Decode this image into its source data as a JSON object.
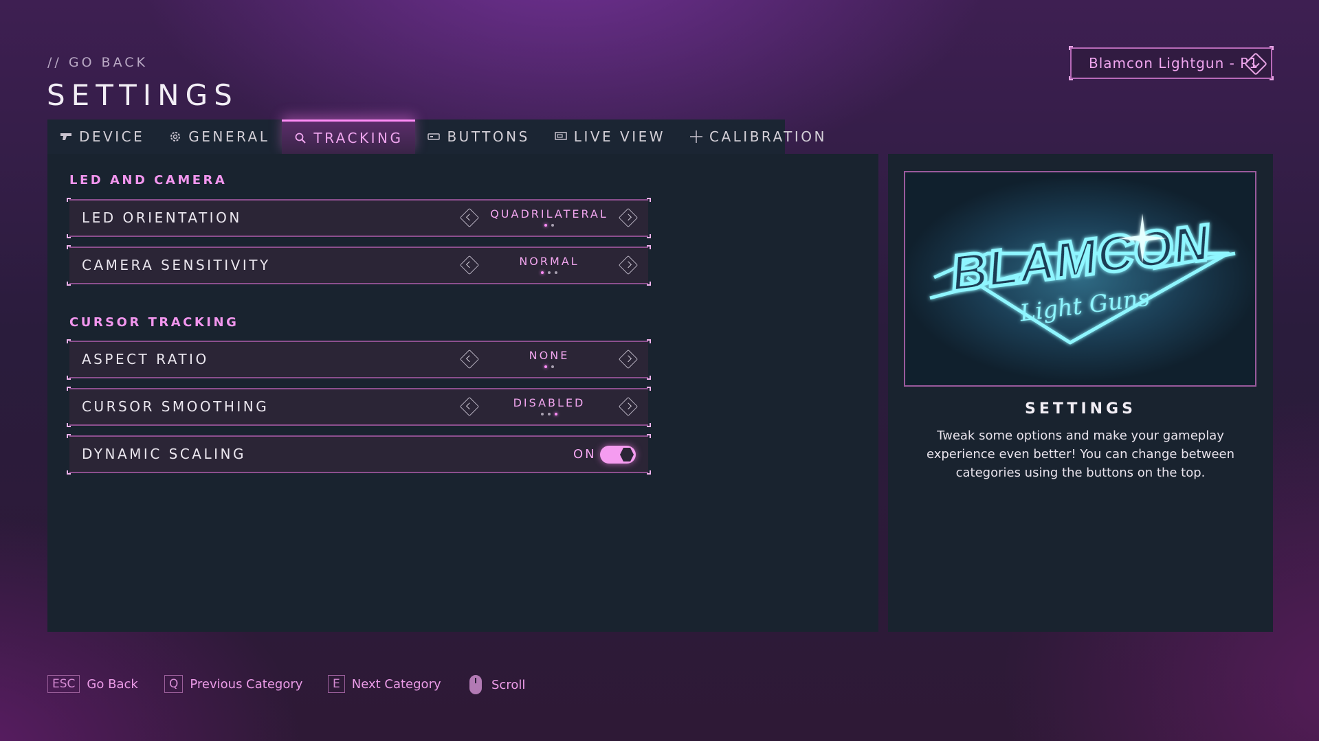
{
  "header": {
    "go_back": "// GO BACK",
    "title": "SETTINGS",
    "device_selector": "Blamcon Lightgun - P1"
  },
  "tabs": [
    {
      "label": "DEVICE",
      "icon": "lightgun-icon",
      "active": false
    },
    {
      "label": "GENERAL",
      "icon": "gear-icon",
      "active": false
    },
    {
      "label": "TRACKING",
      "icon": "search-icon",
      "active": true
    },
    {
      "label": "BUTTONS",
      "icon": "buttons-icon",
      "active": false
    },
    {
      "label": "LIVE VIEW",
      "icon": "monitor-icon",
      "active": false
    },
    {
      "label": "CALIBRATION",
      "icon": "crosshair-icon",
      "active": false
    }
  ],
  "sections": {
    "led_camera": {
      "title": "LED AND CAMERA",
      "led_orientation": {
        "label": "LED ORIENTATION",
        "value": "QUADRILATERAL",
        "option_count": 2,
        "selected_index": 0
      },
      "camera_sensitivity": {
        "label": "CAMERA SENSITIVITY",
        "value": "NORMAL",
        "option_count": 3,
        "selected_index": 0
      }
    },
    "cursor_tracking": {
      "title": "CURSOR TRACKING",
      "aspect_ratio": {
        "label": "ASPECT RATIO",
        "value": "NONE",
        "option_count": 2,
        "selected_index": 0
      },
      "cursor_smoothing": {
        "label": "CURSOR SMOOTHING",
        "value": "DISABLED",
        "option_count": 3,
        "selected_index": 2
      },
      "dynamic_scaling": {
        "label": "DYNAMIC SCALING",
        "value": "ON",
        "enabled": true
      }
    }
  },
  "info": {
    "logo_text": "BLAMCON",
    "logo_subtext": "Light Guns",
    "title": "SETTINGS",
    "description": "Tweak some options and make your gameplay experience even better! You can change between categories using the buttons on the top."
  },
  "footer": {
    "hints": [
      {
        "key": "ESC",
        "label": "Go Back"
      },
      {
        "key": "Q",
        "label": "Previous Category"
      },
      {
        "key": "E",
        "label": "Next Category"
      },
      {
        "key": "mouse-icon",
        "label": "Scroll"
      }
    ]
  },
  "colors": {
    "accent": "#f296ee",
    "panel": "#19232f",
    "row": "#2b2536",
    "logo_cyan": "#7ff3ff"
  }
}
